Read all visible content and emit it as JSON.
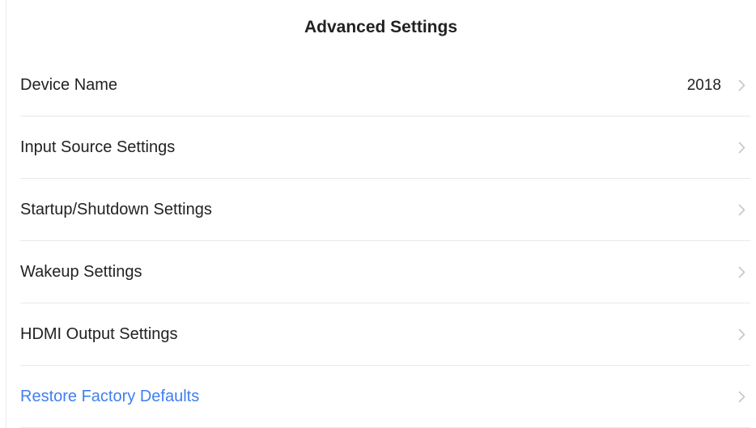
{
  "header": {
    "title": "Advanced Settings"
  },
  "colors": {
    "text": "#222222",
    "accent": "#3f7ff0",
    "divider": "#e8e8e8",
    "chevron": "#c7c7c7"
  },
  "settings": {
    "items": [
      {
        "label": "Device Name",
        "value": "2018",
        "icon": "chevron-right-icon"
      },
      {
        "label": "Input Source Settings",
        "icon": "chevron-right-icon"
      },
      {
        "label": "Startup/Shutdown Settings",
        "icon": "chevron-right-icon"
      },
      {
        "label": "Wakeup Settings",
        "icon": "chevron-right-icon"
      },
      {
        "label": "HDMI Output Settings",
        "icon": "chevron-right-icon"
      },
      {
        "label": "Restore Factory Defaults",
        "icon": "chevron-right-icon"
      }
    ]
  }
}
